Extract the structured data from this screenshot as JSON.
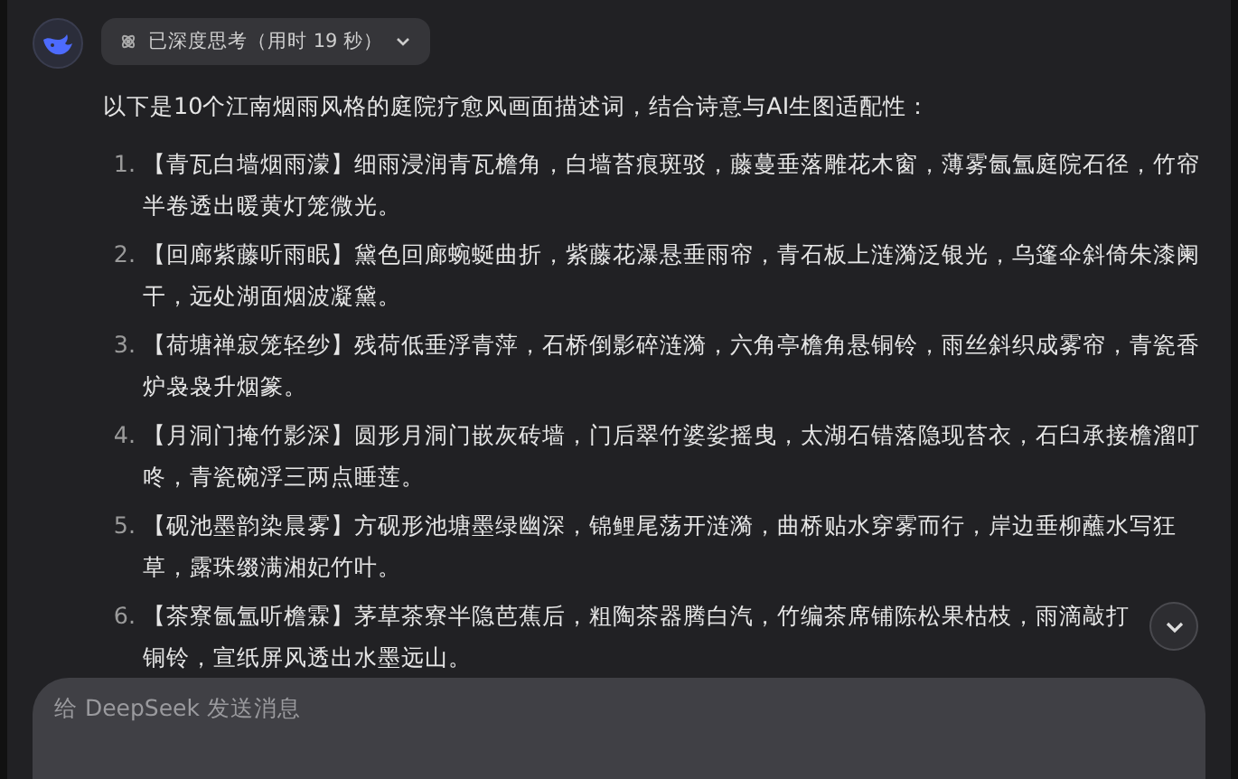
{
  "thinking": {
    "label": "已深度思考（用时 19 秒）",
    "expanded": false
  },
  "intro": "以下是10个江南烟雨风格的庭院疗愈风画面描述词，结合诗意与AI生图适配性：",
  "items": [
    {
      "number": "1.",
      "text": "【青瓦白墙烟雨濛】细雨浸润青瓦檐角，白墙苔痕斑驳，藤蔓垂落雕花木窗，薄雾氤氲庭院石径，竹帘半卷透出暖黄灯笼微光。"
    },
    {
      "number": "2.",
      "text": "【回廊紫藤听雨眠】黛色回廊蜿蜒曲折，紫藤花瀑悬垂雨帘，青石板上涟漪泛银光，乌篷伞斜倚朱漆阑干，远处湖面烟波凝黛。"
    },
    {
      "number": "3.",
      "text": "【荷塘禅寂笼轻纱】残荷低垂浮青萍，石桥倒影碎涟漪，六角亭檐角悬铜铃，雨丝斜织成雾帘，青瓷香炉袅袅升烟篆。"
    },
    {
      "number": "4.",
      "text": "【月洞门掩竹影深】圆形月洞门嵌灰砖墙，门后翠竹婆娑摇曳，太湖石错落隐现苔衣，石臼承接檐溜叮咚，青瓷碗浮三两点睡莲。"
    },
    {
      "number": "5.",
      "text": "【砚池墨韵染晨雾】方砚形池塘墨绿幽深，锦鲤尾荡开涟漪，曲桥贴水穿雾而行，岸边垂柳蘸水写狂草，露珠缀满湘妃竹叶。"
    },
    {
      "number": "6.",
      "text": "【茶寮氤氲听檐霖】茅草茶寮半隐芭蕉后，粗陶茶器腾白汽，竹编茶席铺陈松果枯枝，雨滴敲打铜铃，宣纸屏风透出水墨远山。"
    }
  ],
  "composer": {
    "placeholder": "给 DeepSeek 发送消息"
  }
}
